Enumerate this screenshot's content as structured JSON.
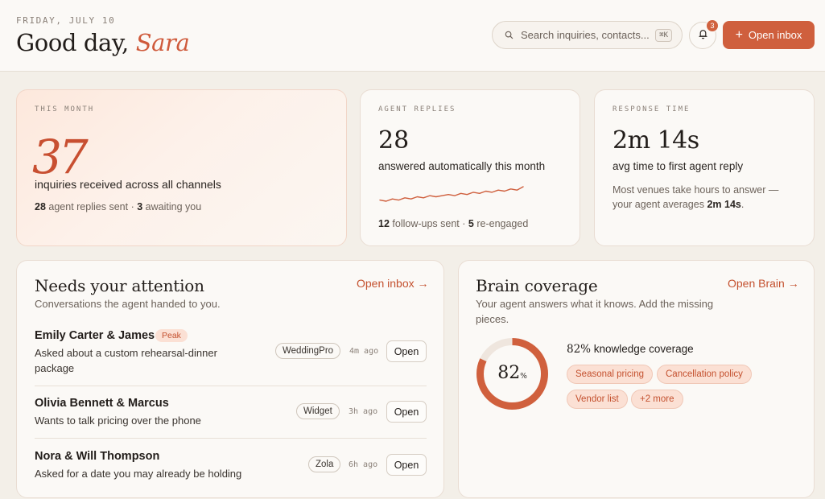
{
  "header": {
    "date": "FRIDAY, JULY 10",
    "greeting": "Good day,",
    "name": "Sara",
    "search_placeholder": "Search inquiries, contacts...",
    "search_shortcut": "⌘K",
    "notification_count": "3",
    "primary_button": "Open inbox",
    "search_icon": "search-icon",
    "bell_icon": "bell-icon",
    "plus_icon": "plus-icon"
  },
  "stats": {
    "this_month": {
      "label": "THIS MONTH",
      "value": "37",
      "subtitle": "inquiries received across all channels",
      "replies_count": "28",
      "replies_text": "agent replies sent",
      "separator": "·",
      "awaiting_count": "3",
      "awaiting_text": "awaiting you"
    },
    "agent_replies": {
      "label": "AGENT REPLIES",
      "value": "28",
      "subtitle": "answered automatically this month",
      "followups_count": "12",
      "followups_text": "follow-ups sent",
      "separator": "·",
      "reengaged_count": "5",
      "reengaged_text": "re-engaged",
      "sparkline": [
        3,
        2,
        4,
        3,
        5,
        4,
        6,
        5,
        7,
        6,
        7,
        8,
        7,
        9,
        8,
        10,
        9,
        11,
        10,
        12,
        11,
        13,
        12,
        15
      ]
    },
    "response_time": {
      "label": "RESPONSE TIME",
      "value": "2m 14s",
      "subtitle": "avg time to first agent reply",
      "note_prefix": "Most venues take hours to answer — your agent averages",
      "note_value": "2m 14s",
      "note_suffix": "."
    }
  },
  "attention": {
    "title": "Needs your attention",
    "subtitle": "Conversations the agent handed to you.",
    "link": "Open inbox →",
    "rows": [
      {
        "name": "Emily Carter & James",
        "badge": "Peak",
        "desc": "Asked about a custom rehearsal-dinner package",
        "source": "WeddingPro",
        "ago": "4m ago",
        "action": "Open"
      },
      {
        "name": "Olivia Bennett & Marcus",
        "badge": "",
        "desc": "Wants to talk pricing over the phone",
        "source": "Widget",
        "ago": "3h ago",
        "action": "Open"
      },
      {
        "name": "Nora & Will Thompson",
        "badge": "",
        "desc": "Asked for a date you may already be holding",
        "source": "Zola",
        "ago": "6h ago",
        "action": "Open"
      }
    ]
  },
  "brain": {
    "title": "Brain coverage",
    "subtitle": "Your agent answers what it knows. Add the missing pieces.",
    "link": "Open Brain →",
    "coverage_value": "82",
    "coverage_pct_sign": "%",
    "coverage_fraction": 0.82,
    "coverage_label_num": "82%",
    "coverage_label_text": "knowledge coverage",
    "tags": [
      "Seasonal pricing",
      "Cancellation policy",
      "Vendor list",
      "+2 more"
    ]
  },
  "colors": {
    "accent": "#cf5f3d",
    "background": "#f3efe8",
    "card": "#fbf9f6",
    "tag_bg": "#fbe0d4"
  }
}
